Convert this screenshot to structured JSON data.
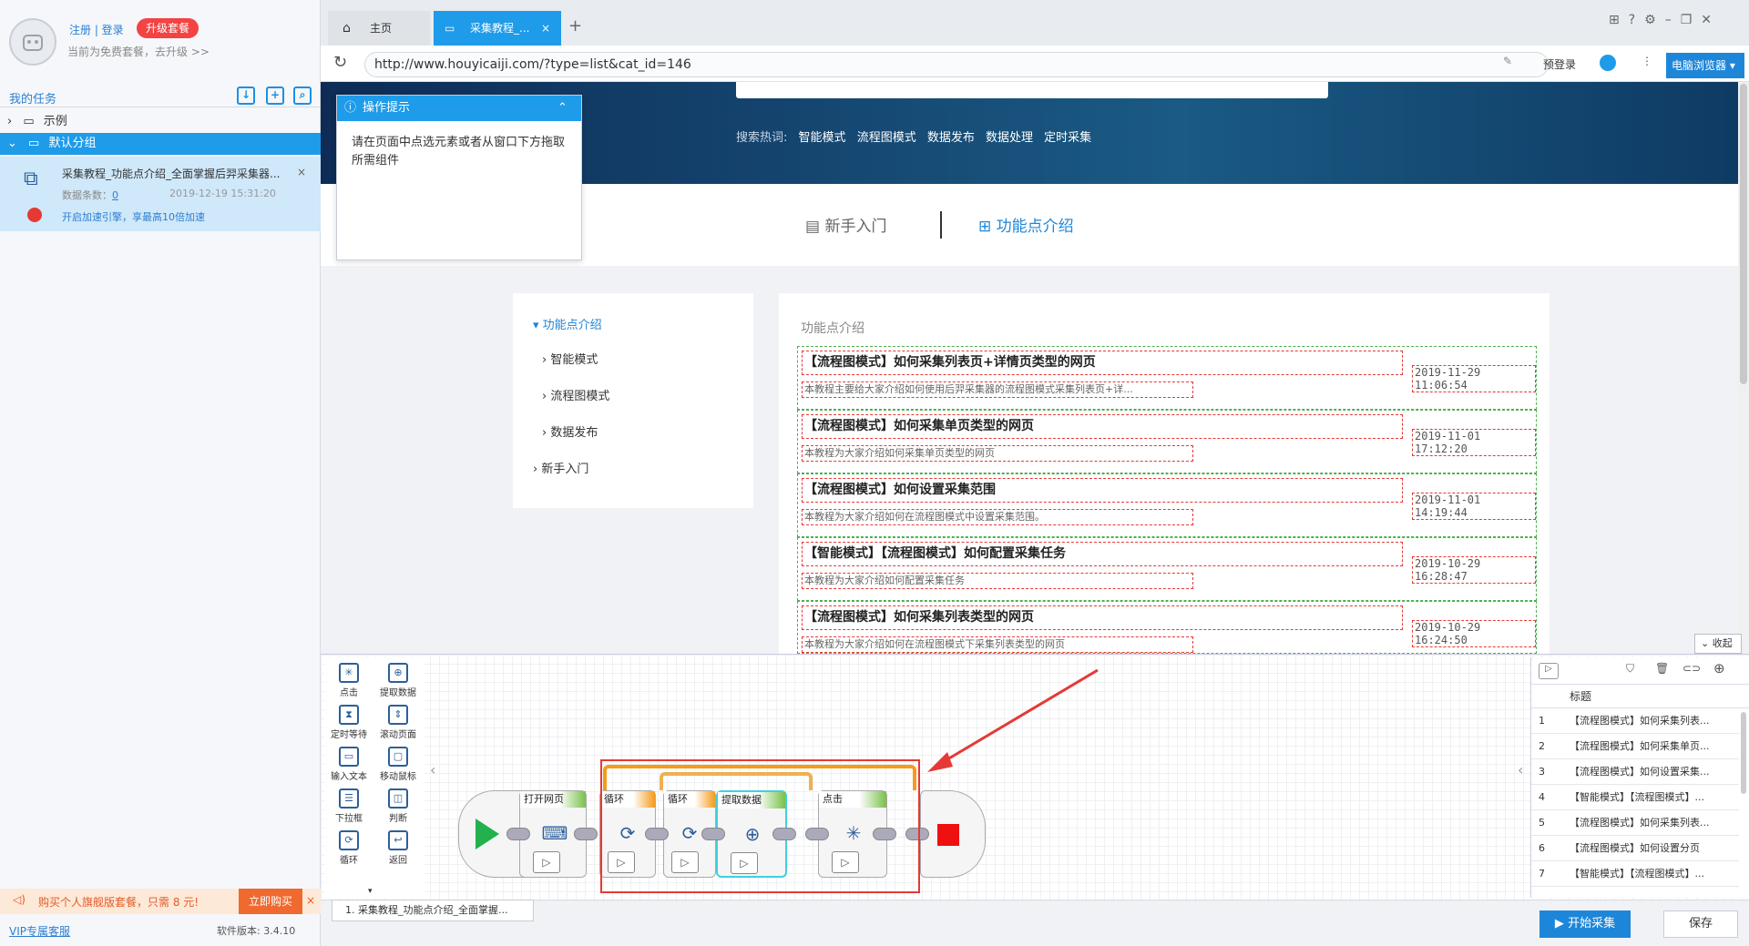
{
  "sidebar": {
    "login": "注册 | 登录",
    "upgrade": "升级套餐",
    "plan": "当前为免费套餐，去升级 >>",
    "my_tasks": "我的任务",
    "tree_example": "示例",
    "tree_default": "默认分组",
    "task_title": "采集教程_功能点介绍_全面掌握后羿采集器...",
    "task_count_label": "数据条数：",
    "task_count": "0",
    "task_date": "2019-12-19 15:31:20",
    "task_speed": "开启加速引擎，享最高10倍加速",
    "promo": "购买个人旗舰版套餐，只需 8 元!",
    "promo_btn": "立即购买",
    "vip": "VIP专属客服",
    "version": "软件版本: 3.4.10"
  },
  "tabs": {
    "home": "主页",
    "active": "采集教程_..."
  },
  "address": {
    "url": "http://www.houyicaiji.com/?type=list&cat_id=146",
    "prelogin": "预登录",
    "browser": "电脑浏览器"
  },
  "page": {
    "hot_label": "搜索热词:",
    "hot_words": [
      "智能模式",
      "流程图模式",
      "数据发布",
      "数据处理",
      "定时采集"
    ],
    "nav_beginner": "新手入门",
    "nav_feature": "功能点介绍",
    "leftnav": [
      "功能点介绍",
      "智能模式",
      "流程图模式",
      "数据发布",
      "新手入门"
    ],
    "content_head": "功能点介绍",
    "articles": [
      {
        "title": "【流程图模式】如何采集列表页+详情页类型的网页",
        "desc": "本教程主要给大家介绍如何使用后羿采集器的流程图模式采集列表页+详...",
        "date": "2019-11-29 11:06:54"
      },
      {
        "title": "【流程图模式】如何采集单页类型的网页",
        "desc": "本教程为大家介绍如何采集单页类型的网页",
        "date": "2019-11-01 17:12:20"
      },
      {
        "title": "【流程图模式】如何设置采集范围",
        "desc": "本教程为大家介绍如何在流程图模式中设置采集范围。",
        "date": "2019-11-01 14:19:44"
      },
      {
        "title": "【智能模式】【流程图模式】如何配置采集任务",
        "desc": "本教程为大家介绍如何配置采集任务",
        "date": "2019-10-29 16:28:47"
      },
      {
        "title": "【流程图模式】如何采集列表类型的网页",
        "desc": "本教程为大家介绍如何在流程图模式下采集列表类型的网页",
        "date": "2019-10-29 16:24:50"
      }
    ],
    "collapse": "收起"
  },
  "tip": {
    "title": "操作提示",
    "body": "请在页面中点选元素或者从窗口下方拖取所需组件"
  },
  "palette": [
    "点击",
    "提取数据",
    "定时等待",
    "滚动页面",
    "输入文本",
    "移动鼠标",
    "下拉框",
    "判断",
    "循环",
    "返回"
  ],
  "flow": {
    "n1": "打开网页",
    "n2": "循环",
    "n3": "循环",
    "n4": "提取数据",
    "n5": "点击"
  },
  "rpanel": {
    "col": "标题",
    "rows": [
      "【流程图模式】如何采集列表...",
      "【流程图模式】如何采集单页...",
      "【流程图模式】如何设置采集...",
      "【智能模式】【流程图模式】...",
      "【流程图模式】如何采集列表...",
      "【流程图模式】如何设置分页",
      "【智能模式】【流程图模式】..."
    ]
  },
  "bottom": {
    "task_tab": "1. 采集教程_功能点介绍_全面掌握...",
    "start": "开始采集",
    "save": "保存"
  }
}
